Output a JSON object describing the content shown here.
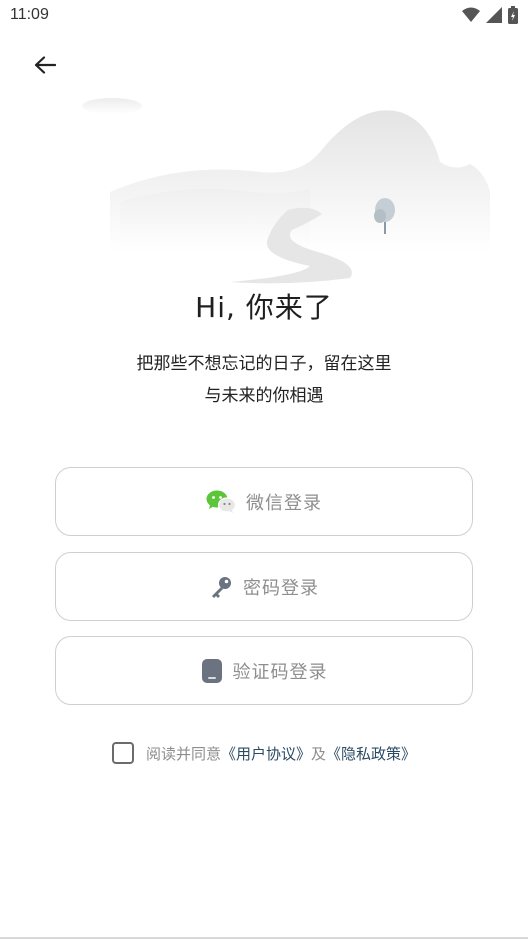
{
  "status_bar": {
    "time": "11:09",
    "icons": [
      "wifi-icon",
      "signal-icon",
      "battery-charging-icon"
    ]
  },
  "nav": {
    "back_icon": "arrow-left-icon"
  },
  "hero": {
    "illustration": "misty-mountains-river-tree"
  },
  "greeting": "Hi, 你来了",
  "tagline": {
    "line1": "把那些不想忘记的日子，留在这里",
    "line2": "与未来的你相遇"
  },
  "login_options": {
    "wechat": {
      "label": "微信登录",
      "icon": "wechat-icon"
    },
    "password": {
      "label": "密码登录",
      "icon": "key-icon"
    },
    "sms": {
      "label": "验证码登录",
      "icon": "phone-icon"
    }
  },
  "agreement": {
    "prefix": "阅读并同意",
    "user_agreement": "《用户协议》",
    "conjunction": "及",
    "privacy_policy": "《隐私政策》",
    "checked": false
  },
  "colors": {
    "link": "#2b4b63",
    "button_text": "#8e8e8e",
    "button_border": "#cfcfcf",
    "wechat_green": "#5cc53a"
  }
}
